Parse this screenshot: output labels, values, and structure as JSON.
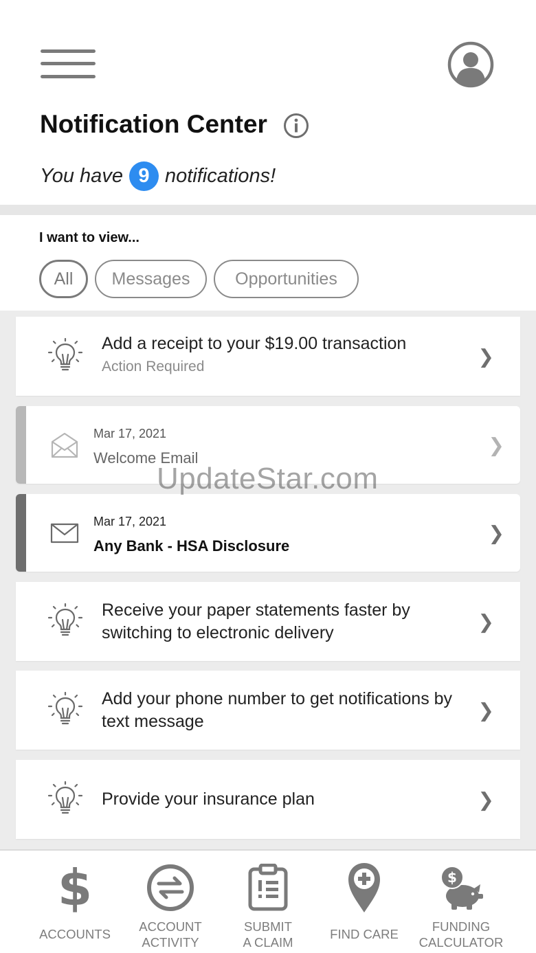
{
  "header": {
    "title": "Notification Center",
    "summary_prefix": "You have",
    "notification_count": "9",
    "summary_suffix": "notifications!"
  },
  "filter": {
    "label": "I want to view...",
    "options": [
      "All",
      "Messages",
      "Opportunities"
    ],
    "selected": "All"
  },
  "notifications": [
    {
      "type": "opportunity",
      "title": "Add a receipt to your $19.00 transaction",
      "subtitle": "Action Required"
    },
    {
      "type": "message",
      "date": "Mar 17, 2021",
      "subject": "Welcome Email",
      "read": true
    },
    {
      "type": "message",
      "date": "Mar 17, 2021",
      "subject": "Any Bank - HSA Disclosure",
      "read": false
    },
    {
      "type": "opportunity",
      "title": "Receive your paper statements faster by switching to electronic delivery"
    },
    {
      "type": "opportunity",
      "title": "Add your phone number to get notifications by text message"
    },
    {
      "type": "opportunity",
      "title": "Provide your insurance plan"
    }
  ],
  "watermark": "UpdateStar.com",
  "bottom_nav": [
    {
      "line1": "ACCOUNTS",
      "line2": "",
      "icon": "dollar-icon"
    },
    {
      "line1": "ACCOUNT",
      "line2": "ACTIVITY",
      "icon": "transfer-icon"
    },
    {
      "line1": "SUBMIT",
      "line2": "A CLAIM",
      "icon": "clipboard-icon"
    },
    {
      "line1": "FIND CARE",
      "line2": "",
      "icon": "location-plus-icon"
    },
    {
      "line1": "FUNDING",
      "line2": "CALCULATOR",
      "icon": "piggy-bank-icon"
    }
  ],
  "colors": {
    "badge": "#2d8cf0",
    "icon_gray": "#7a7a7a",
    "read_bar": "#b8b8b8",
    "unread_bar": "#6e6e6e"
  },
  "chevron": "❯"
}
